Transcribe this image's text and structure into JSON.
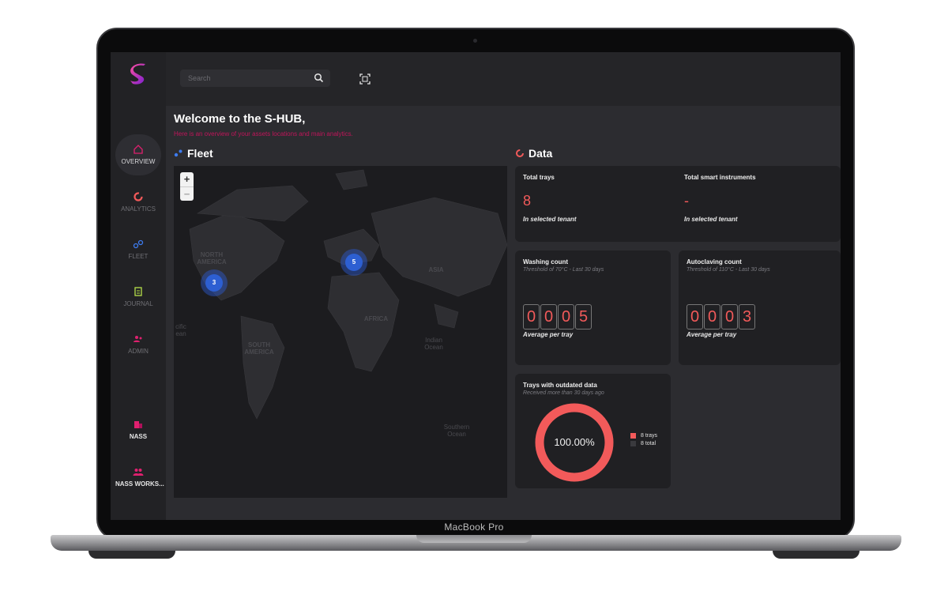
{
  "device": {
    "label": "MacBook Pro"
  },
  "sidebar": {
    "items": [
      {
        "label": "OVERVIEW",
        "icon": "home-icon",
        "active": true
      },
      {
        "label": "ANALYTICS",
        "icon": "analytics-ring-icon",
        "active": false
      },
      {
        "label": "FLEET",
        "icon": "fleet-dots-icon",
        "active": false
      },
      {
        "label": "JOURNAL",
        "icon": "journal-icon",
        "active": false
      },
      {
        "label": "ADMIN",
        "icon": "users-icon",
        "active": false
      }
    ],
    "bottom": [
      {
        "label": "NASS",
        "icon": "building-icon"
      },
      {
        "label": "NASS WORKS...",
        "icon": "team-icon"
      }
    ]
  },
  "topbar": {
    "search": {
      "placeholder": "Search",
      "value": ""
    },
    "scan_icon": "qr-scan-icon"
  },
  "header": {
    "title": "Welcome to the S-HUB,",
    "subtitle": "Here is an overview of your assets locations and main analytics."
  },
  "fleet": {
    "title": "Fleet",
    "zoom_in": "+",
    "zoom_out": "−",
    "clusters": [
      {
        "count": "3"
      },
      {
        "count": "5"
      }
    ],
    "labels": {
      "north_america": "NORTH AMERICA",
      "south_america": "SOUTH AMERICA",
      "africa": "AFRICA",
      "asia": "ASIA",
      "indian_ocean": "Indian Ocean",
      "southern_ocean": "Southern Ocean",
      "pacific": "cific ean"
    }
  },
  "data": {
    "title": "Data",
    "total_trays": {
      "title": "Total trays",
      "value": "8",
      "caption": "In selected tenant"
    },
    "total_instruments": {
      "title": "Total smart instruments",
      "value": "-",
      "caption": "In selected tenant"
    },
    "washing": {
      "title": "Washing count",
      "subtitle": "Threshold of 70°C - Last 30 days",
      "digits": [
        "0",
        "0",
        "0",
        "5"
      ],
      "caption": "Average per tray"
    },
    "autoclaving": {
      "title": "Autoclaving count",
      "subtitle": "Threshold of 110°C - Last 30 days",
      "digits": [
        "0",
        "0",
        "0",
        "3"
      ],
      "caption": "Average per tray"
    },
    "outdated": {
      "title": "Trays with outdated data",
      "subtitle": "Received more than 30 days ago",
      "percent_label": "100.00%",
      "percent_value": 100,
      "legend": [
        {
          "label": "8 trays",
          "color": "#f25a5a"
        },
        {
          "label": "8 total",
          "color": "#3a3a3e"
        }
      ]
    }
  },
  "colors": {
    "accent": "#f25a5a",
    "brand": "#c0155a",
    "cluster": "#2d5fd2"
  }
}
